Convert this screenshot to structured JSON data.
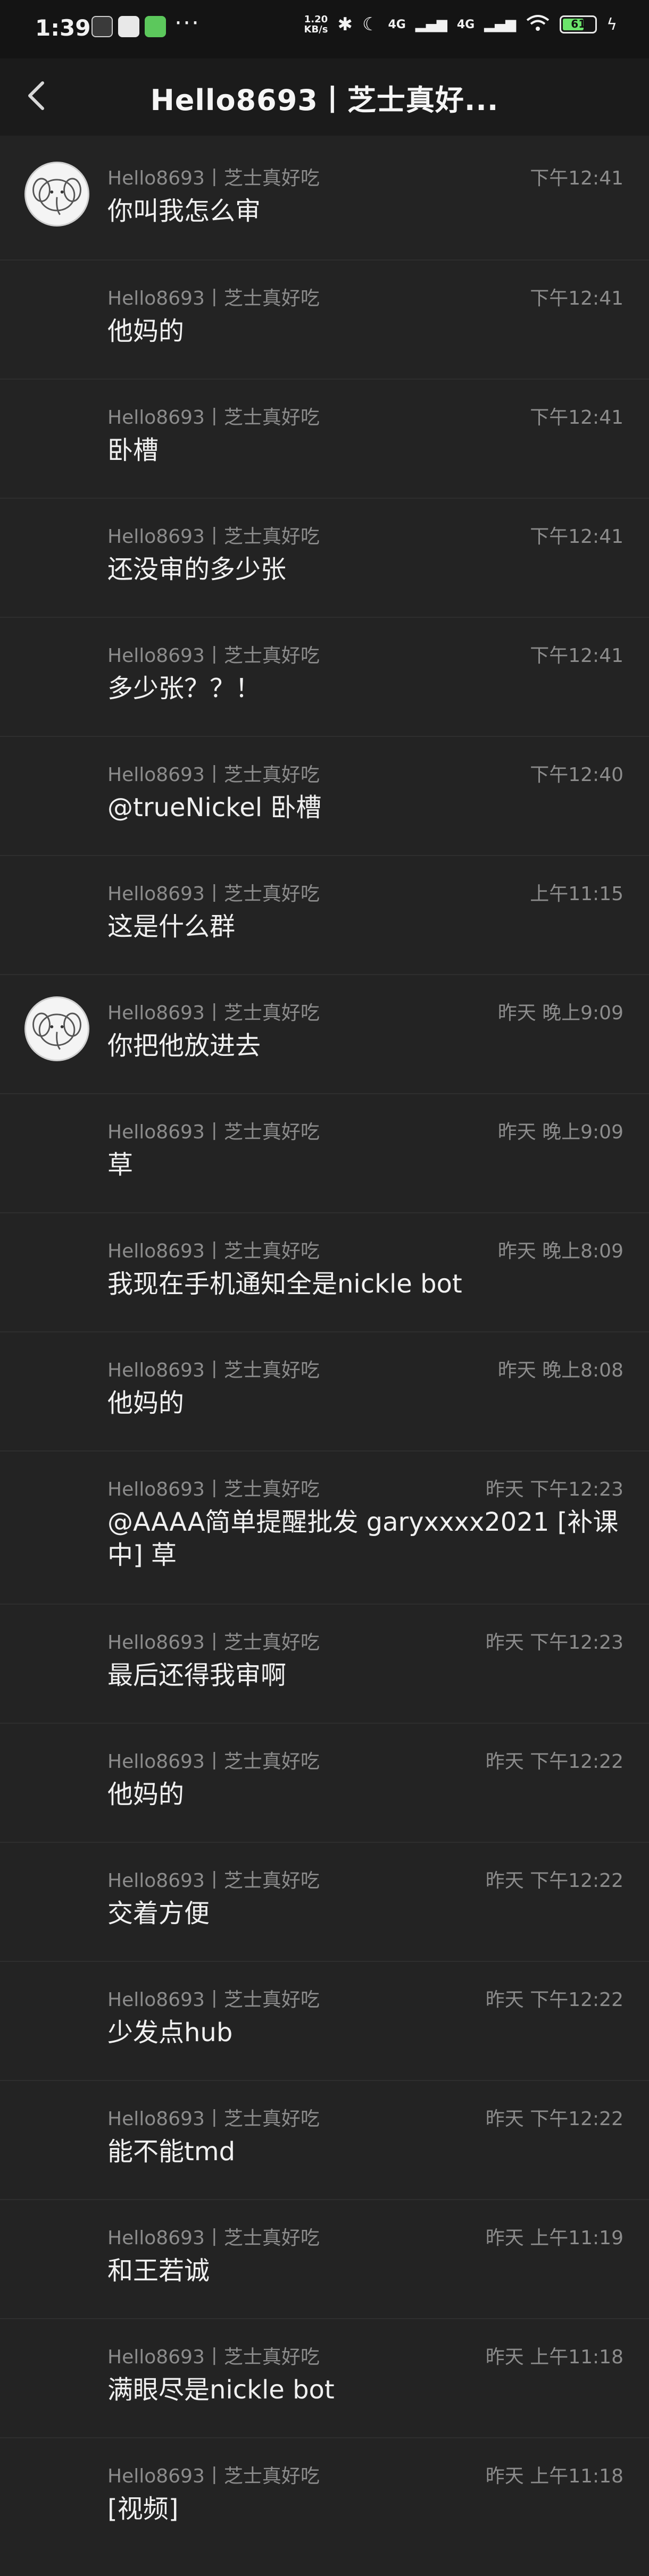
{
  "status_bar": {
    "time": "1:39",
    "dots": "···",
    "net_speed_value": "1.20",
    "net_speed_unit": "KB/s",
    "signal1": "4G",
    "signal2": "4G",
    "battery_level": "61",
    "battery_color": "#6be36b"
  },
  "header": {
    "title": "Hello8693丨芝士真好..."
  },
  "messages": [
    {
      "sender": "Hello8693丨芝士真好吃",
      "time": "下午12:41",
      "text": "你叫我怎么审",
      "avatar": true
    },
    {
      "sender": "Hello8693丨芝士真好吃",
      "time": "下午12:41",
      "text": "他妈的",
      "avatar": false
    },
    {
      "sender": "Hello8693丨芝士真好吃",
      "time": "下午12:41",
      "text": "卧槽",
      "avatar": false
    },
    {
      "sender": "Hello8693丨芝士真好吃",
      "time": "下午12:41",
      "text": "还没审的多少张",
      "avatar": false
    },
    {
      "sender": "Hello8693丨芝士真好吃",
      "time": "下午12:41",
      "text": "多少张？？！",
      "avatar": false
    },
    {
      "sender": "Hello8693丨芝士真好吃",
      "time": "下午12:40",
      "text": "@trueNickel 卧槽",
      "avatar": false
    },
    {
      "sender": "Hello8693丨芝士真好吃",
      "time": "上午11:15",
      "text": "这是什么群",
      "avatar": false
    },
    {
      "sender": "Hello8693丨芝士真好吃",
      "time": "昨天 晚上9:09",
      "text": "你把他放进去",
      "avatar": true
    },
    {
      "sender": "Hello8693丨芝士真好吃",
      "time": "昨天 晚上9:09",
      "text": "草",
      "avatar": false
    },
    {
      "sender": "Hello8693丨芝士真好吃",
      "time": "昨天 晚上8:09",
      "text": "我现在手机通知全是nickle bot",
      "avatar": false
    },
    {
      "sender": "Hello8693丨芝士真好吃",
      "time": "昨天 晚上8:08",
      "text": "他妈的",
      "avatar": false
    },
    {
      "sender": "Hello8693丨芝士真好吃",
      "time": "昨天 下午12:23",
      "text": "@AAAA简单提醒批发 garyxxxx2021 [补课中] 草",
      "avatar": false
    },
    {
      "sender": "Hello8693丨芝士真好吃",
      "time": "昨天 下午12:23",
      "text": "最后还得我审啊",
      "avatar": false
    },
    {
      "sender": "Hello8693丨芝士真好吃",
      "time": "昨天 下午12:22",
      "text": "他妈的",
      "avatar": false
    },
    {
      "sender": "Hello8693丨芝士真好吃",
      "time": "昨天 下午12:22",
      "text": "交着方便",
      "avatar": false
    },
    {
      "sender": "Hello8693丨芝士真好吃",
      "time": "昨天 下午12:22",
      "text": "少发点hub",
      "avatar": false
    },
    {
      "sender": "Hello8693丨芝士真好吃",
      "time": "昨天 下午12:22",
      "text": "能不能tmd",
      "avatar": false
    },
    {
      "sender": "Hello8693丨芝士真好吃",
      "time": "昨天 上午11:19",
      "text": "和王若诚",
      "avatar": false
    },
    {
      "sender": "Hello8693丨芝士真好吃",
      "time": "昨天 上午11:18",
      "text": "满眼尽是nickle bot",
      "avatar": false
    },
    {
      "sender": "Hello8693丨芝士真好吃",
      "time": "昨天 上午11:18",
      "text": "[视频]",
      "avatar": false
    }
  ]
}
